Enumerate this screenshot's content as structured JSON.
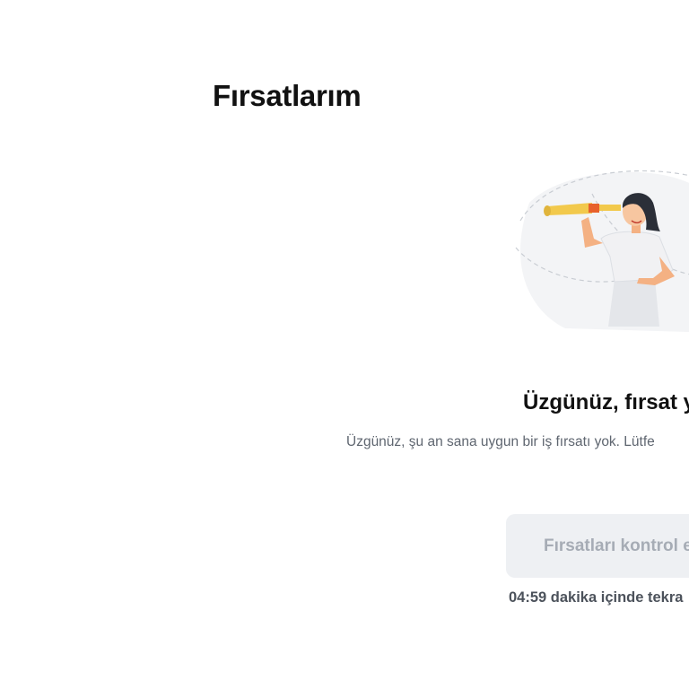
{
  "page": {
    "title": "Fırsatlarım"
  },
  "empty_state": {
    "illustration": "woman-with-telescope-illustration",
    "title": "Üzgünüz, fırsat y",
    "description": "Üzgünüz, şu an sana uygun bir iş fırsatı yok. Lütfe",
    "button_label": "Fırsatları kontrol e",
    "retry_countdown": "04:59 dakika içinde tekra"
  },
  "colors": {
    "background": "#ffffff",
    "title_text": "#111111",
    "description_text": "#5f6670",
    "button_background": "#eef0f3",
    "button_text": "#a6acb5",
    "telescope": "#f2c94c",
    "telescope_band": "#e8612c"
  }
}
